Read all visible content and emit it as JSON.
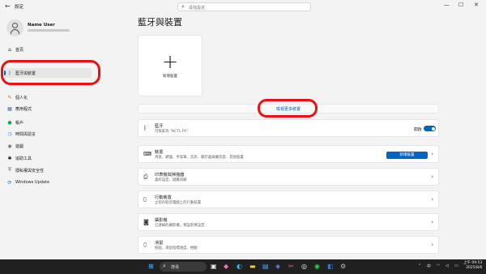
{
  "window": {
    "title": "設定",
    "back": "←",
    "min": "—",
    "max": "☐",
    "close": "✕"
  },
  "search": {
    "placeholder": "尋找設定",
    "icon": "search-icon"
  },
  "user": {
    "name": "Name User"
  },
  "sidebar": {
    "items": [
      {
        "label": "首頁",
        "icon": "⌂",
        "icon_name": "home-icon"
      },
      {
        "label": "藍牙與裝置",
        "icon": "ᛒ",
        "icon_name": "bluetooth-icon",
        "active": true
      },
      {
        "label": "個人化",
        "icon": "✎",
        "icon_name": "personalization-icon"
      },
      {
        "label": "應用程式",
        "icon": "▦",
        "icon_name": "apps-icon"
      },
      {
        "label": "帳戶",
        "icon": "●",
        "icon_name": "accounts-icon"
      },
      {
        "label": "時間與語言",
        "icon": "◷",
        "icon_name": "time-language-icon"
      },
      {
        "label": "遊戲",
        "icon": "◉",
        "icon_name": "gaming-icon"
      },
      {
        "label": "協助工具",
        "icon": "✱",
        "icon_name": "accessibility-icon"
      },
      {
        "label": "隱私權與安全性",
        "icon": "⛨",
        "icon_name": "privacy-shield-icon"
      },
      {
        "label": "Windows Update",
        "icon": "⟳",
        "icon_name": "windows-update-icon"
      }
    ]
  },
  "main": {
    "title": "藍牙與裝置",
    "add_device": {
      "plus": "+",
      "label": "新增裝置"
    },
    "more_devices": "檢視更多裝置",
    "bluetooth": {
      "title": "藍牙",
      "subtitle": "可探索為 \"NCTL-PC\"",
      "toggle_label": "開啟",
      "on": true
    },
    "cards": [
      {
        "title": "裝置",
        "subtitle": "滑鼠、鍵盤、手寫筆、音訊、顯示器與擴充座、其他裝置",
        "icon": "⌨",
        "icon_name": "devices-icon",
        "button": "新增裝置"
      },
      {
        "title": "印表機與掃描器",
        "subtitle": "喜好設定、疑難排解",
        "icon": "⎙",
        "icon_name": "printer-icon"
      },
      {
        "title": "行動裝置",
        "subtitle": "立即存取您電腦上的行動裝置",
        "icon": "▯",
        "icon_name": "mobile-device-icon"
      },
      {
        "title": "攝影機",
        "subtitle": "已連線的攝影機，預設影像設定",
        "icon": "◙",
        "icon_name": "camera-icon"
      },
      {
        "title": "滑鼠",
        "subtitle": "按鈕、滑鼠指標速度、捲動",
        "icon": "⬯",
        "icon_name": "mouse-icon"
      }
    ]
  },
  "taskbar": {
    "search_label": "搜尋",
    "time": "上午 09:53",
    "date": "2025/8/6",
    "lang": "中",
    "apps": [
      {
        "name": "start-button",
        "glyph": "⊞",
        "color": "#5fb8f5"
      },
      {
        "name": "task-view-button",
        "glyph": "▣",
        "color": "#eeeeee"
      },
      {
        "name": "copilot-icon",
        "glyph": "◆",
        "color": "#e77ab5"
      },
      {
        "name": "edge-icon",
        "glyph": "◐",
        "color": "#3bb0ea"
      },
      {
        "name": "file-explorer-icon",
        "glyph": "▬",
        "color": "#f2c94c"
      },
      {
        "name": "store-icon",
        "glyph": "▤",
        "color": "#4aa3ea"
      },
      {
        "name": "teams-icon",
        "glyph": "◈",
        "color": "#7b83eb"
      },
      {
        "name": "snipping-tool-icon",
        "glyph": "✂",
        "color": "#e95d8c"
      },
      {
        "name": "chatgpt-icon",
        "glyph": "◎",
        "color": "#eeeeee"
      },
      {
        "name": "xbox-icon",
        "glyph": "◉",
        "color": "#34c759"
      },
      {
        "name": "outlook-icon",
        "glyph": "◧",
        "color": "#2b7cd3"
      },
      {
        "name": "settings-icon",
        "glyph": "⚙",
        "color": "#bbbbbb"
      }
    ]
  },
  "colors": {
    "accent": "#0067c0",
    "highlight": "#ee1010",
    "background": "#f3f3f3"
  }
}
